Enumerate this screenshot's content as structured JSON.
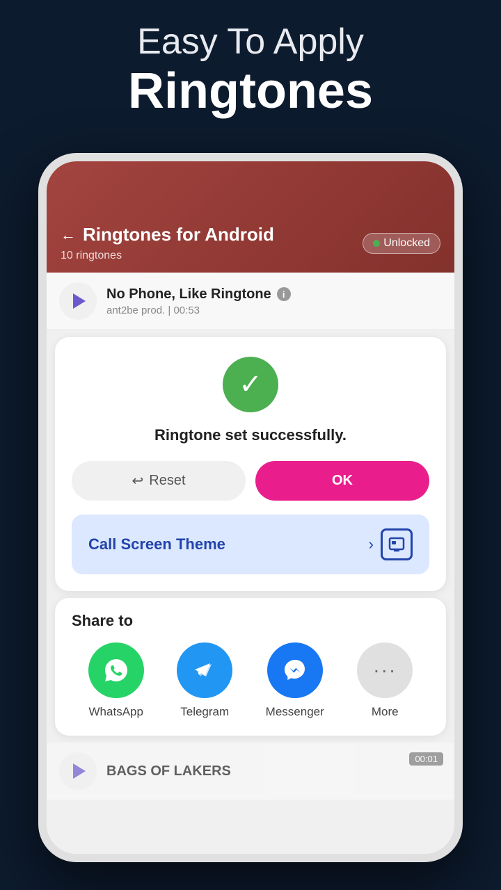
{
  "background": {
    "subtitle": "Easy To Apply",
    "title": "Ringtones"
  },
  "phone": {
    "header": {
      "back_icon": "←",
      "title": "Ringtones for Android",
      "count": "10 ringtones",
      "unlocked_label": "Unlocked"
    },
    "song": {
      "title": "No Phone, Like Ringtone",
      "meta": "ant2be prod. | 00:53"
    },
    "modal": {
      "success_message": "Ringtone set successfully.",
      "reset_label": "Reset",
      "ok_label": "OK",
      "reset_icon": "↩",
      "call_screen_label": "Call Screen Theme",
      "call_screen_chevron": "›"
    },
    "share": {
      "title": "Share to",
      "apps": [
        {
          "name": "WhatsApp",
          "class": "whatsapp",
          "icon": "●"
        },
        {
          "name": "Telegram",
          "class": "telegram",
          "icon": "✈"
        },
        {
          "name": "Messenger",
          "class": "messenger",
          "icon": "⚡"
        },
        {
          "name": "More",
          "class": "more",
          "icon": "···"
        }
      ]
    },
    "bottom_song": {
      "title": "BAGS OF LAKERS",
      "time": "00:01"
    }
  }
}
